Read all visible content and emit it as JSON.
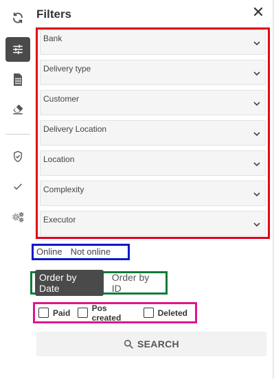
{
  "panel": {
    "title": "Filters"
  },
  "rail": {
    "items": [
      {
        "icon": "refresh-icon"
      },
      {
        "icon": "sliders-icon",
        "active": true
      },
      {
        "icon": "calculator-document-icon"
      },
      {
        "icon": "eraser-icon"
      },
      {
        "icon": "shield-check-icon"
      },
      {
        "icon": "check-icon"
      },
      {
        "icon": "gears-icon"
      }
    ]
  },
  "dropdowns": [
    {
      "label": "Bank"
    },
    {
      "label": "Delivery type"
    },
    {
      "label": "Customer"
    },
    {
      "label": "Delivery Location"
    },
    {
      "label": "Location"
    },
    {
      "label": "Complexity"
    },
    {
      "label": "Executor"
    }
  ],
  "online_toggle": {
    "options": [
      "Online",
      "Not online"
    ]
  },
  "order_toggle": {
    "options": [
      "Order by Date",
      "Order by ID"
    ],
    "selected": "Order by Date"
  },
  "checkboxes": [
    {
      "label": "Paid",
      "checked": false
    },
    {
      "label": "Pos created",
      "checked": false
    },
    {
      "label": "Deleted",
      "checked": false
    }
  ],
  "search": {
    "label": "SEARCH"
  },
  "colors": {
    "dropdown_frame": "#e0001b",
    "online_frame": "#0a18c8",
    "order_frame": "#0f7a3a",
    "checkbox_frame": "#e0148c",
    "active_fill": "#4a4a4a"
  }
}
